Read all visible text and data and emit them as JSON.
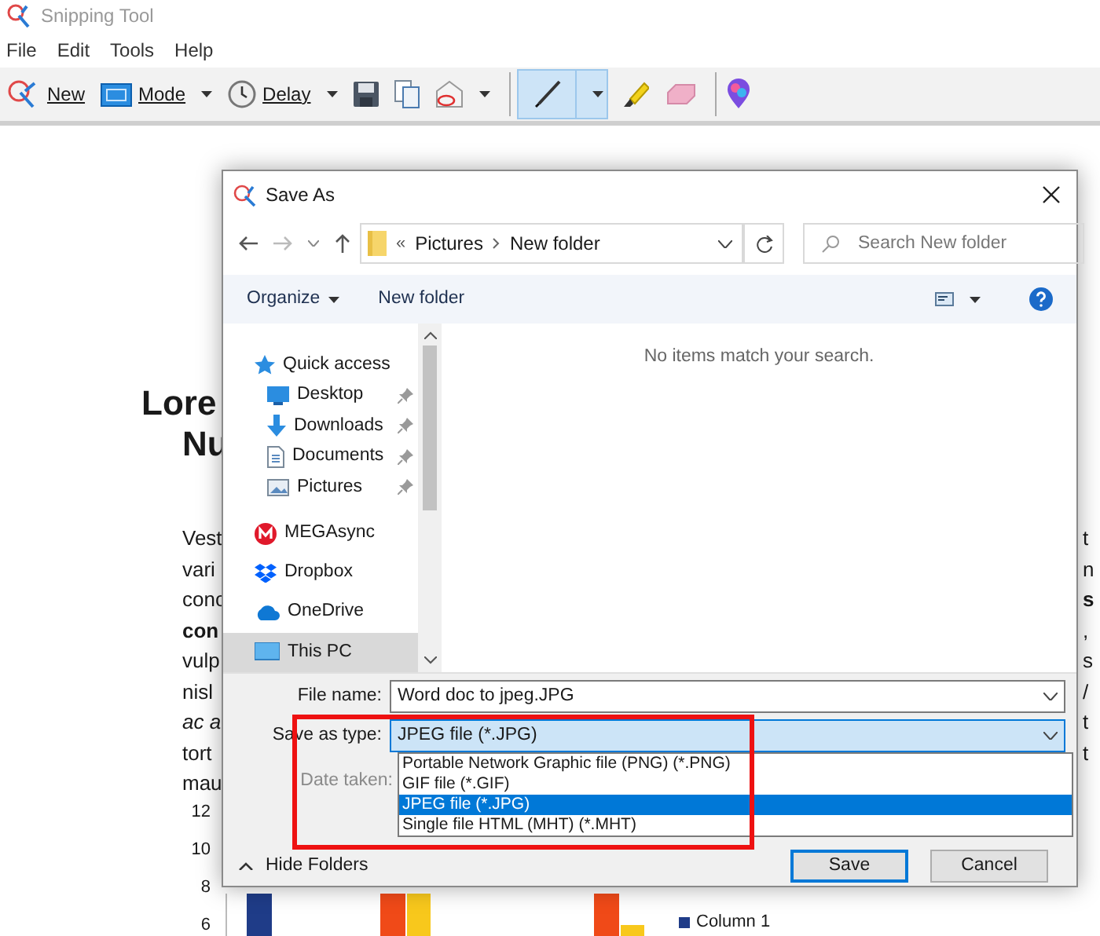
{
  "app": {
    "title": "Snipping Tool"
  },
  "menu": [
    "File",
    "Edit",
    "Tools",
    "Help"
  ],
  "toolbar_groups": [
    [
      {
        "kind": "new",
        "label": "New",
        "dropdown": false,
        "selected": false
      },
      {
        "kind": "mode",
        "label": "Mode",
        "dropdown": true,
        "selected": false
      },
      {
        "kind": "delay",
        "label": "Delay",
        "dropdown": true,
        "selected": false
      },
      {
        "kind": "save",
        "dropdown": false,
        "selected": false
      },
      {
        "kind": "copy",
        "dropdown": false,
        "selected": false
      },
      {
        "kind": "send",
        "dropdown": true,
        "selected": false
      }
    ],
    [
      {
        "kind": "pen",
        "dropdown": true,
        "selected": true
      },
      {
        "kind": "highlighter",
        "dropdown": false,
        "selected": false
      },
      {
        "kind": "eraser",
        "dropdown": false,
        "selected": false
      }
    ],
    [
      {
        "kind": "paint3d",
        "dropdown": false,
        "selected": false
      }
    ]
  ],
  "document": {
    "heading_lines": [
      "Lore",
      "Nu"
    ],
    "body_lines": [
      {
        "start": "Vest",
        "start_bold": false,
        "start_italic": false,
        "end": "t",
        "end_bold": false
      },
      {
        "start": "vari",
        "start_bold": false,
        "start_italic": false,
        "end": "n",
        "end_bold": false
      },
      {
        "start": "conc",
        "start_bold": false,
        "start_italic": false,
        "end": "s",
        "end_bold": true
      },
      {
        "start": "con",
        "start_bold": true,
        "start_italic": false,
        "end": ",",
        "end_bold": false
      },
      {
        "start": "vulp",
        "start_bold": false,
        "start_italic": false,
        "end": "s",
        "end_bold": false
      },
      {
        "start": "nisl",
        "start_bold": false,
        "start_italic": false,
        "end": "/",
        "end_bold": false
      },
      {
        "start": "ac a",
        "start_bold": false,
        "start_italic": true,
        "end": "t",
        "end_bold": false
      },
      {
        "start": "tort",
        "start_bold": false,
        "start_italic": false,
        "end": "t",
        "end_bold": false
      },
      {
        "start": "mau",
        "start_bold": false,
        "start_italic": false
      }
    ],
    "chart": {
      "y_tick_labels": [
        "12",
        "10",
        "8",
        "6"
      ],
      "legend": [
        {
          "label": "Column 1",
          "color": "#1f3c88"
        }
      ]
    }
  },
  "dialog": {
    "title": "Save As",
    "address": {
      "overflow_marker": "«",
      "path": [
        "Pictures",
        "New folder"
      ]
    },
    "search": {
      "placeholder": "Search New folder"
    },
    "commands": [
      {
        "label": "Organize",
        "dropdown": true
      },
      {
        "label": "New folder",
        "dropdown": false
      }
    ],
    "nav_items": [
      {
        "kind": "quick_access",
        "label": "Quick access",
        "pinned": false,
        "selected": false,
        "children": [
          {
            "kind": "desktop",
            "label": "Desktop",
            "pinned": true,
            "selected": false
          },
          {
            "kind": "downloads",
            "label": "Downloads",
            "pinned": true,
            "selected": false
          },
          {
            "kind": "documents",
            "label": "Documents",
            "pinned": true,
            "selected": false
          },
          {
            "kind": "pictures",
            "label": "Pictures",
            "pinned": true,
            "selected": false
          }
        ]
      },
      {
        "kind": "mega",
        "label": "MEGAsync",
        "pinned": false,
        "selected": false
      },
      {
        "kind": "dropbox",
        "label": "Dropbox",
        "pinned": false,
        "selected": false
      },
      {
        "kind": "onedrive",
        "label": "OneDrive",
        "pinned": false,
        "selected": false
      },
      {
        "kind": "pc",
        "label": "This PC",
        "pinned": false,
        "selected": true
      }
    ],
    "empty_message": "No items match your search.",
    "file_name": {
      "label": "File name:",
      "value": "Word doc to jpeg.JPG"
    },
    "save_as_type": {
      "label": "Save as type:",
      "value": "JPEG file (*.JPG)",
      "expanded": true,
      "options": [
        {
          "label": "Portable Network Graphic file (PNG) (*.PNG)",
          "selected": false
        },
        {
          "label": "GIF file (*.GIF)",
          "selected": false
        },
        {
          "label": "JPEG file (*.JPG)",
          "selected": true
        },
        {
          "label": "Single file HTML (MHT) (*.MHT)",
          "selected": false
        }
      ]
    },
    "date_taken": {
      "label": "Date taken:",
      "disabled": true
    },
    "hide_folders": "Hide Folders",
    "buttons": [
      {
        "label": "Save",
        "default": true
      },
      {
        "label": "Cancel",
        "default": false
      }
    ]
  }
}
